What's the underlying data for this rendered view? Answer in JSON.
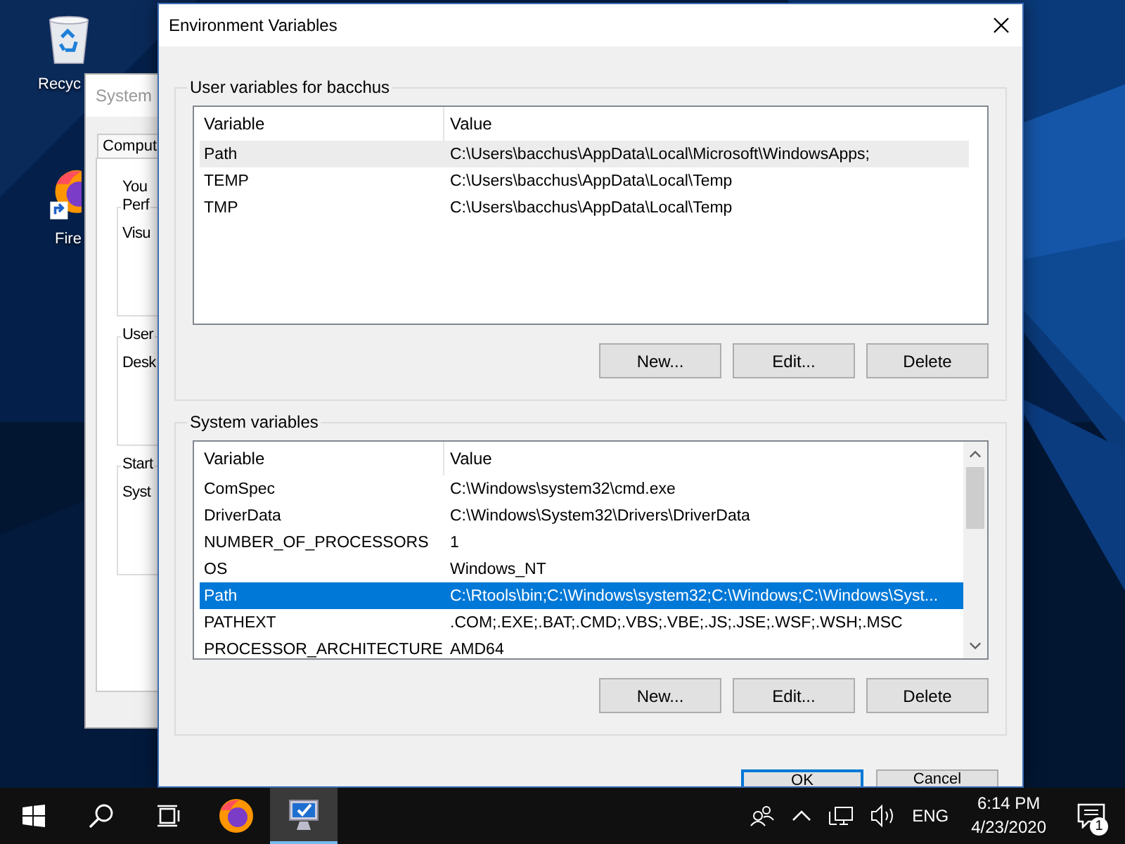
{
  "desktop": {
    "icons": [
      {
        "kind": "recycle",
        "label": "Recyc"
      },
      {
        "kind": "firefox",
        "label": "Fire"
      }
    ]
  },
  "background_window": {
    "title": "System",
    "tab": "Comput",
    "intro": "You",
    "groups": [
      {
        "title": "Perf",
        "text": "Visu"
      },
      {
        "title": "User",
        "text": "Desk"
      },
      {
        "title": "Start",
        "text": "Syst"
      }
    ]
  },
  "dialog": {
    "title": "Environment Variables",
    "user_variables": {
      "title": "User variables for bacchus",
      "focused": false,
      "columns": [
        "Variable",
        "Value"
      ],
      "rows": [
        {
          "variable": "Path",
          "value": "C:\\Users\\bacchus\\AppData\\Local\\Microsoft\\WindowsApps;",
          "selected": true
        },
        {
          "variable": "TEMP",
          "value": "C:\\Users\\bacchus\\AppData\\Local\\Temp",
          "selected": false
        },
        {
          "variable": "TMP",
          "value": "C:\\Users\\bacchus\\AppData\\Local\\Temp",
          "selected": false
        }
      ],
      "buttons": [
        "New...",
        "Edit...",
        "Delete"
      ]
    },
    "system_variables": {
      "title": "System variables",
      "focused": true,
      "columns": [
        "Variable",
        "Value"
      ],
      "rows": [
        {
          "variable": "ComSpec",
          "value": "C:\\Windows\\system32\\cmd.exe",
          "selected": false
        },
        {
          "variable": "DriverData",
          "value": "C:\\Windows\\System32\\Drivers\\DriverData",
          "selected": false
        },
        {
          "variable": "NUMBER_OF_PROCESSORS",
          "value": "1",
          "selected": false
        },
        {
          "variable": "OS",
          "value": "Windows_NT",
          "selected": false
        },
        {
          "variable": "Path",
          "value": "C:\\Rtools\\bin;C:\\Windows\\system32;C:\\Windows;C:\\Windows\\Syst...",
          "selected": true
        },
        {
          "variable": "PATHEXT",
          "value": ".COM;.EXE;.BAT;.CMD;.VBS;.VBE;.JS;.JSE;.WSF;.WSH;.MSC",
          "selected": false
        },
        {
          "variable": "PROCESSOR_ARCHITECTURE",
          "value": "AMD64",
          "selected": false
        }
      ],
      "buttons": [
        "New...",
        "Edit...",
        "Delete"
      ]
    },
    "footer_buttons": [
      "OK",
      "Cancel"
    ]
  },
  "taskbar": {
    "apps": [
      {
        "kind": "firefox",
        "selected": false
      },
      {
        "kind": "system",
        "selected": true
      }
    ],
    "language": "ENG",
    "time": "6:14 PM",
    "date": "4/23/2020",
    "notification_count": "1"
  }
}
